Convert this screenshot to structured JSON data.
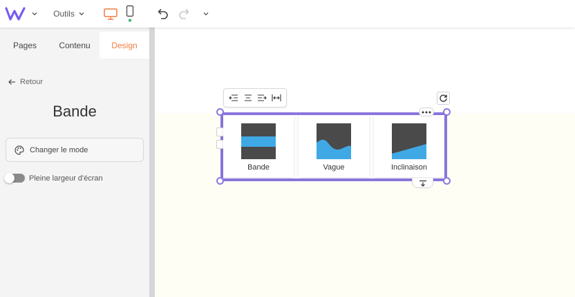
{
  "topbar": {
    "logo": "w-logo-icon",
    "tools_label": "Outils",
    "icons": [
      "chevron-down-icon",
      "desktop-icon",
      "mobile-icon",
      "undo-icon",
      "redo-icon"
    ]
  },
  "sidebar": {
    "tabs": [
      {
        "label": "Pages"
      },
      {
        "label": "Contenu"
      },
      {
        "label": "Design"
      }
    ],
    "active_tab": "Design",
    "back_label": "Retour",
    "title": "Bande",
    "mode_button_label": "Changer le mode",
    "fullwidth_label": "Pleine largeur d'écran",
    "fullwidth_on": false
  },
  "canvas": {
    "options": [
      {
        "label": "Bande"
      },
      {
        "label": "Vague"
      },
      {
        "label": "Inclinaison"
      }
    ]
  },
  "colors": {
    "accent": "#f07b3f",
    "selection": "#8b77e0",
    "preview_dark": "#4a4a4a",
    "preview_blue": "#3fa9e6",
    "active_dot": "#26b36b"
  }
}
